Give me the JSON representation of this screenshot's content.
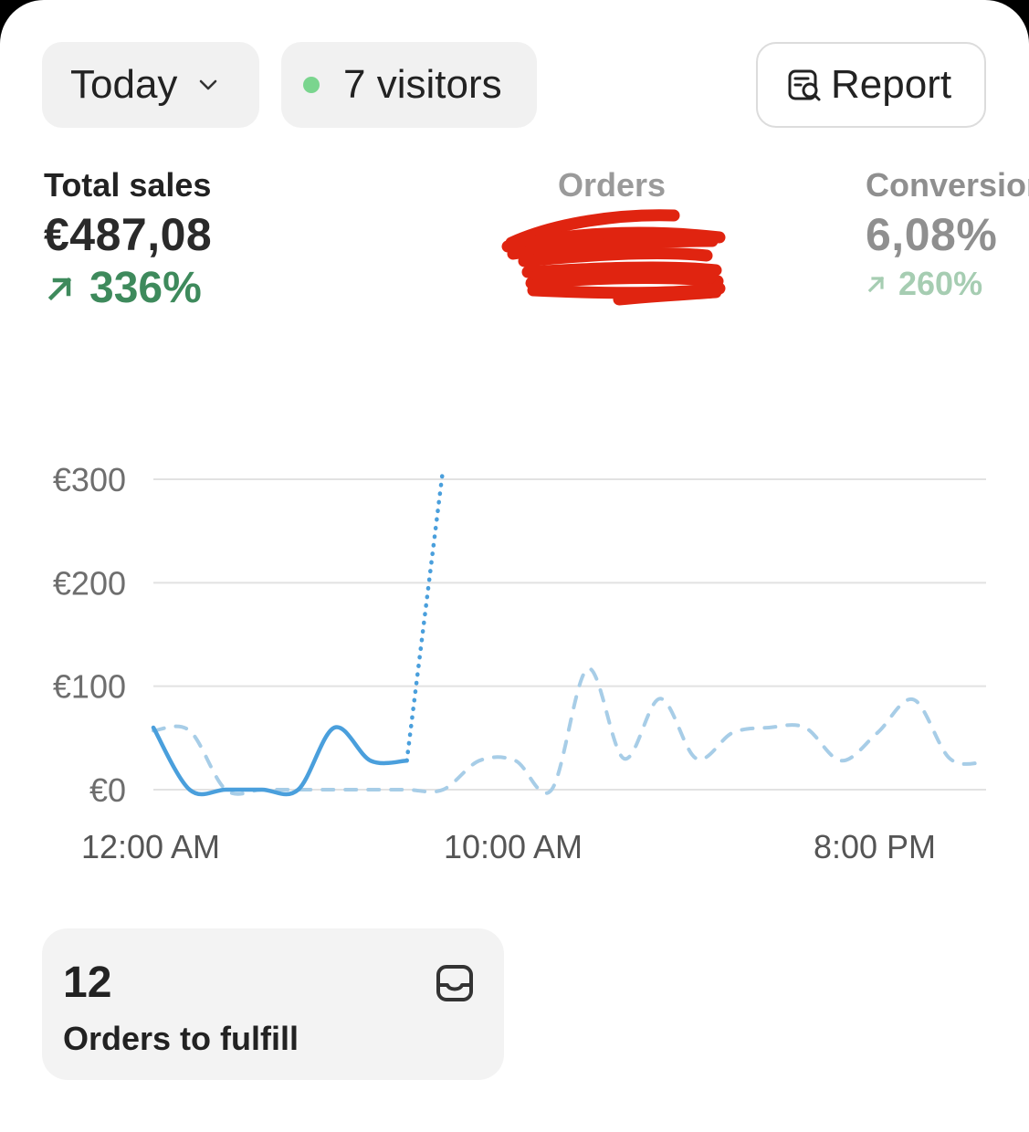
{
  "header": {
    "period_label": "Today",
    "visitors_label": "7 visitors",
    "report_label": "Report"
  },
  "metrics": {
    "total_sales": {
      "label": "Total sales",
      "value": "€487,08",
      "change": "336%"
    },
    "orders": {
      "label": "Orders"
    },
    "conversion": {
      "label": "Conversion",
      "value": "6,08%",
      "change": "260%"
    }
  },
  "colors": {
    "accent_blue": "#4a9fdc",
    "comparison_blue": "#a7cde7",
    "positive_green": "#3e8a5c",
    "live_dot": "#7ad58e",
    "redaction": "#e02410"
  },
  "chart_data": {
    "type": "line",
    "y_ticks": [
      "€300",
      "€200",
      "€100",
      "€0"
    ],
    "x_ticks": [
      "12:00 AM",
      "10:00 AM",
      "8:00 PM"
    ],
    "ylim": [
      0,
      300
    ],
    "x_hours_range": [
      0,
      23
    ],
    "grid": true,
    "series": [
      {
        "style": "solid",
        "points": [
          [
            0,
            60
          ],
          [
            1,
            0
          ],
          [
            2,
            0
          ],
          [
            3,
            0
          ],
          [
            4,
            0
          ],
          [
            5,
            60
          ],
          [
            6,
            28
          ],
          [
            7,
            28
          ]
        ]
      },
      {
        "style": "dotted",
        "points": [
          [
            7,
            28
          ],
          [
            8,
            310
          ]
        ]
      },
      {
        "style": "dashed",
        "points": [
          [
            0,
            57
          ],
          [
            1,
            57
          ],
          [
            2,
            0
          ],
          [
            3,
            0
          ],
          [
            4,
            0
          ],
          [
            5,
            0
          ],
          [
            6,
            0
          ],
          [
            7,
            0
          ],
          [
            8,
            0
          ],
          [
            9,
            28
          ],
          [
            10,
            28
          ],
          [
            11,
            0
          ],
          [
            12,
            117
          ],
          [
            13,
            30
          ],
          [
            14,
            88
          ],
          [
            15,
            30
          ],
          [
            16,
            55
          ],
          [
            17,
            60
          ],
          [
            18,
            60
          ],
          [
            19,
            28
          ],
          [
            20,
            55
          ],
          [
            21,
            87
          ],
          [
            22,
            30
          ],
          [
            23,
            27
          ]
        ]
      }
    ]
  },
  "fulfill": {
    "count": "12",
    "label": "Orders to fulfill"
  }
}
